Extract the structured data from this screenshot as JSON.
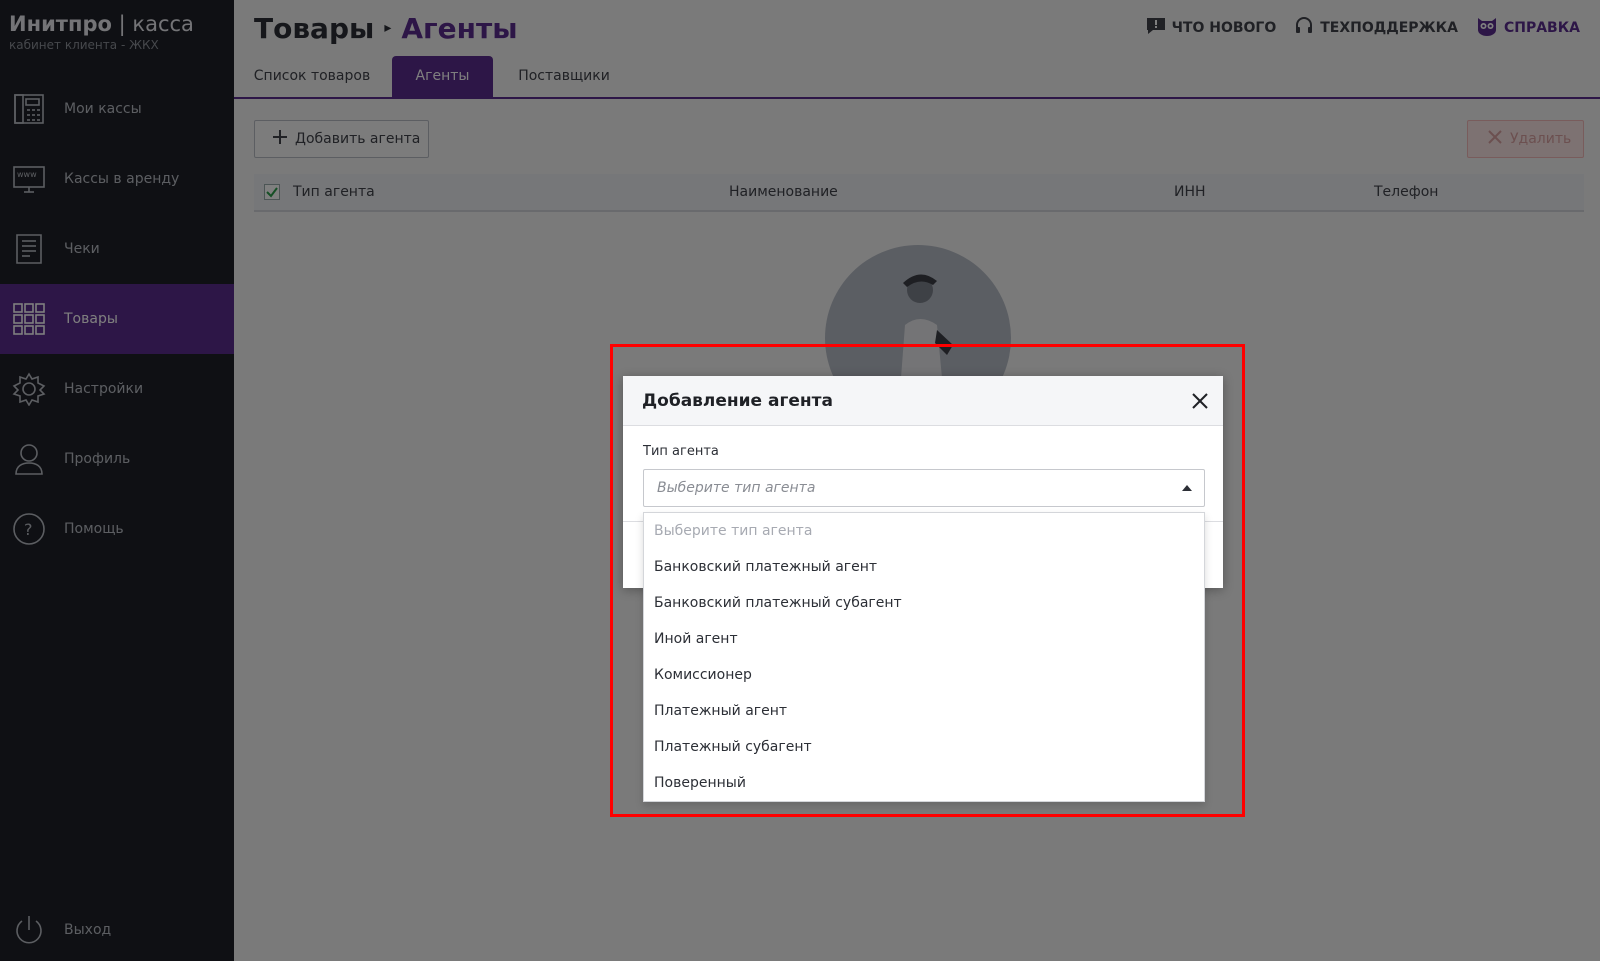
{
  "brand": {
    "name_bold": "Инитпро",
    "separator": "|",
    "name_light": "касса",
    "subtitle": "кабинет клиента - ЖКХ"
  },
  "sidebar": {
    "items": [
      {
        "label": "Мои кассы",
        "icon": "cash-register-icon"
      },
      {
        "label": "Кассы в аренду",
        "icon": "www-monitor-icon"
      },
      {
        "label": "Чеки",
        "icon": "receipt-icon"
      },
      {
        "label": "Товары",
        "icon": "grid-icon",
        "active": true
      },
      {
        "label": "Настройки",
        "icon": "gear-icon"
      },
      {
        "label": "Профиль",
        "icon": "user-icon"
      },
      {
        "label": "Помощь",
        "icon": "help-icon"
      }
    ],
    "logout": "Выход"
  },
  "header": {
    "crumb_root": "Товары",
    "crumb_current": "Агенты",
    "links": {
      "whats_new": "ЧТО НОВОГО",
      "support": "ТЕХПОДДЕРЖКА",
      "help": "СПРАВКА"
    }
  },
  "tabs": [
    "Список товаров",
    "Агенты",
    "Поставщики"
  ],
  "toolbar": {
    "add_label": "Добавить агента",
    "delete_label": "Удалить"
  },
  "table": {
    "columns": [
      "Тип агента",
      "Наименование",
      "ИНН",
      "Телефон"
    ]
  },
  "modal": {
    "title": "Добавление агента",
    "field_label": "Тип агента",
    "select_placeholder": "Выберите тип агента",
    "options": [
      "Выберите тип агента",
      "Банковский платежный агент",
      "Банковский платежный субагент",
      "Иной агент",
      "Комиссионер",
      "Платежный агент",
      "Платежный субагент",
      "Поверенный"
    ]
  },
  "colors": {
    "accent": "#5b2d8e",
    "sidebar_bg": "#1e2128",
    "highlight": "#ff0000"
  }
}
